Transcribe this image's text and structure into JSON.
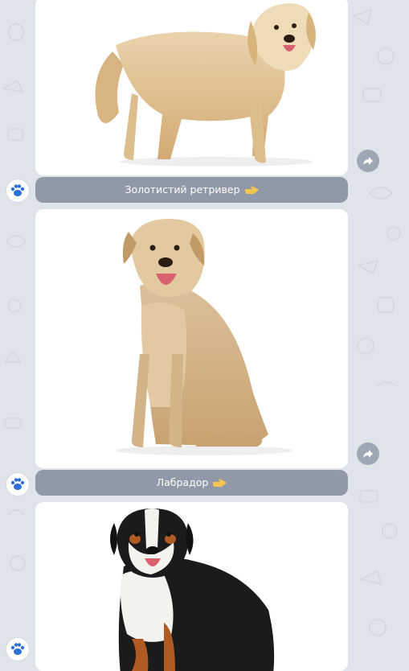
{
  "chat": {
    "messages": [
      {
        "caption": "Золотистий ретривер",
        "caption_icon": "pointing-hand-icon"
      },
      {
        "caption": "Лабрадор",
        "caption_icon": "pointing-hand-icon"
      },
      {
        "caption": "",
        "caption_icon": ""
      }
    ],
    "avatar_icon": "paw-icon",
    "share_icon": "share-arrow-icon"
  },
  "colors": {
    "background": "#dfe3ea",
    "caption_button": "#8f99a7",
    "share_button": "#9ea8b4",
    "paw": "#2f6fd6"
  }
}
